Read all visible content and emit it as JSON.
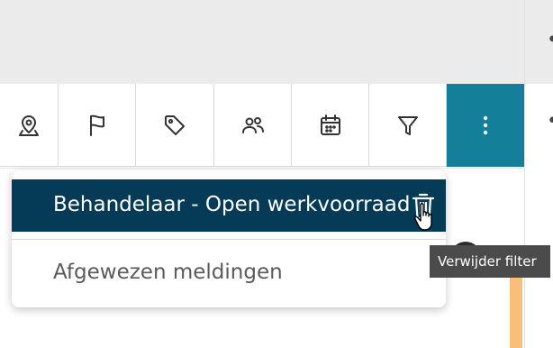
{
  "toolbar": {
    "buttons": [
      {
        "name": "location",
        "icon": "map-pin-icon"
      },
      {
        "name": "flag",
        "icon": "flag-icon"
      },
      {
        "name": "tag",
        "icon": "tag-icon"
      },
      {
        "name": "users",
        "icon": "users-icon"
      },
      {
        "name": "calendar",
        "icon": "calendar-icon"
      },
      {
        "name": "filter",
        "icon": "funnel-icon"
      },
      {
        "name": "more",
        "icon": "more-vertical-icon",
        "active": true
      }
    ],
    "active_color": "#137f98"
  },
  "filter_menu": {
    "items": [
      {
        "label": "Behandelaar - Open werkvoorraad",
        "selected": true,
        "delete_icon": "trash-icon"
      },
      {
        "label": "Afgewezen meldingen",
        "selected": false
      }
    ],
    "selected_color": "#053b56"
  },
  "tooltip": {
    "text": "Verwijder filter"
  },
  "row_action": {
    "icon": "more-horizontal-icon",
    "text": "•••"
  },
  "status_color": "#f7bf78"
}
